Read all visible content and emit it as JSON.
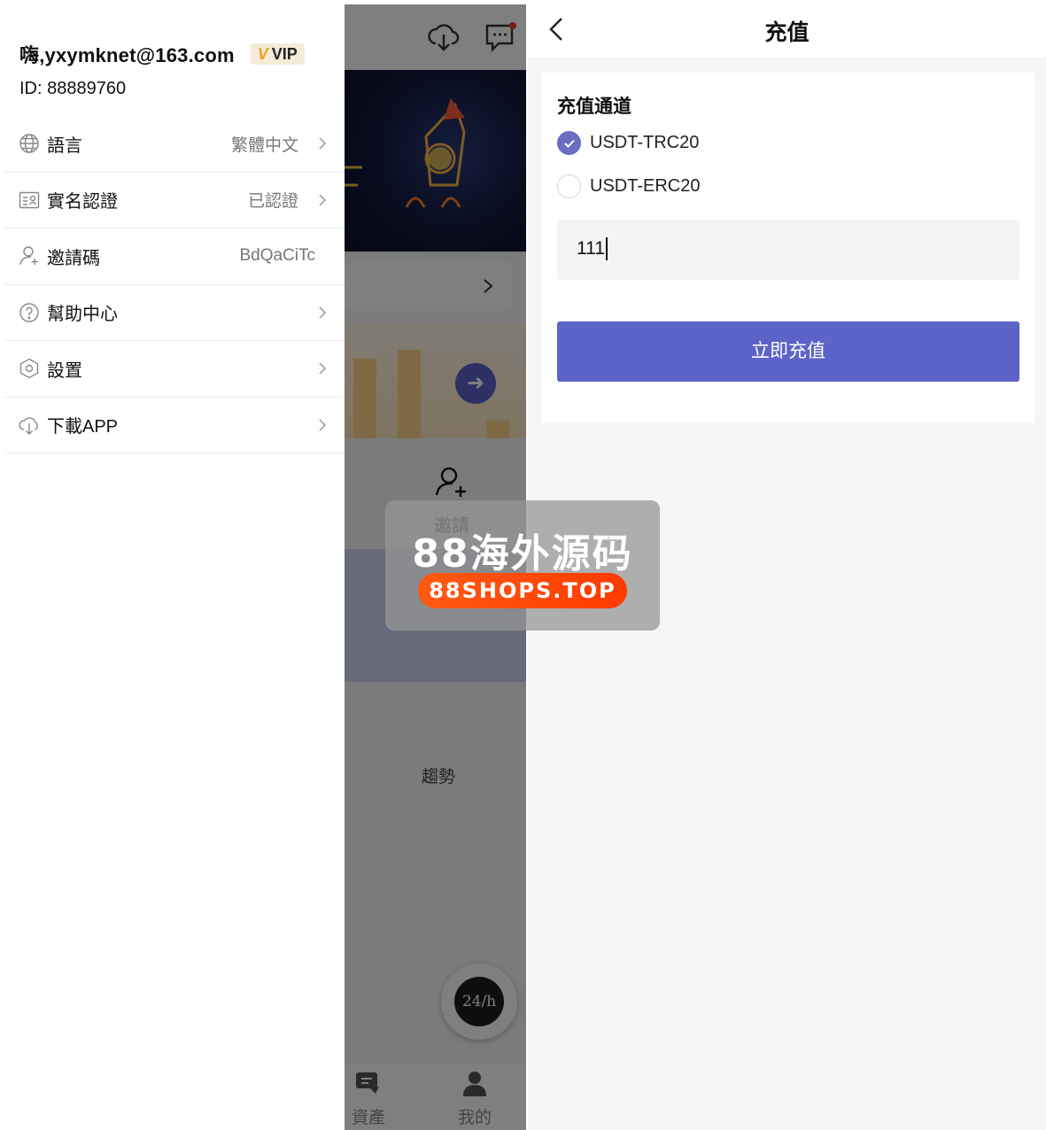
{
  "drawer": {
    "greeting": "嗨,yxymknet@163.com",
    "vip_label": "VIP",
    "user_id": "ID: 88889760",
    "menu": [
      {
        "label": "語言",
        "value": "繁體中文",
        "icon": "globe-icon"
      },
      {
        "label": "實名認證",
        "value": "已認證",
        "icon": "id-card-icon"
      },
      {
        "label": "邀請碼",
        "value": "BdQaCiTc",
        "icon": "user-add-icon"
      },
      {
        "label": "幫助中心",
        "value": "",
        "icon": "help-circle-icon"
      },
      {
        "label": "設置",
        "value": "",
        "icon": "settings-hexagon-icon"
      },
      {
        "label": "下載APP",
        "value": "",
        "icon": "cloud-download-icon"
      }
    ]
  },
  "background_app": {
    "invite_label": "邀請",
    "trend_label": "趨勢",
    "chat_badge": "24/h",
    "tabs": [
      {
        "label": "資產",
        "icon": "wallet-icon"
      },
      {
        "label": "我的",
        "icon": "person-icon"
      }
    ]
  },
  "recharge": {
    "title": "充值",
    "section_title": "充值通道",
    "channels": [
      {
        "label": "USDT-TRC20",
        "checked": true
      },
      {
        "label": "USDT-ERC20",
        "checked": false
      }
    ],
    "amount_value": "111",
    "submit_label": "立即充值"
  },
  "watermark": {
    "title": "88海外源码",
    "url": "88SHOPS.TOP"
  },
  "colors": {
    "accent": "#5c63c9",
    "radio_checked": "#6a6dc1",
    "vip_mark": "#f39b1c",
    "watermark_pill": "#ff4a0a"
  }
}
